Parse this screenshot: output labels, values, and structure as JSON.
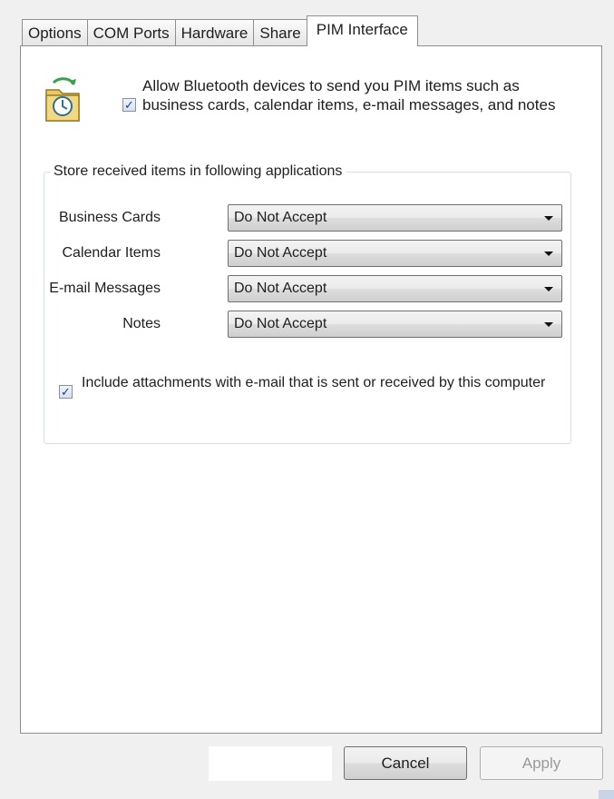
{
  "tabs": [
    {
      "label": "Options"
    },
    {
      "label": "COM Ports"
    },
    {
      "label": "Hardware"
    },
    {
      "label": "Share"
    },
    {
      "label": "PIM Interface"
    }
  ],
  "allow_pim": {
    "checked": true,
    "label": "Allow Bluetooth devices to send you PIM items such as business cards, calendar items, e-mail messages, and notes",
    "check_glyph": "✓"
  },
  "store_group": {
    "title": "Store received items in following applications",
    "rows": [
      {
        "label": "Business Cards",
        "value": "Do Not Accept"
      },
      {
        "label": "Calendar Items",
        "value": "Do Not Accept"
      },
      {
        "label": "E-mail Messages",
        "value": "Do Not Accept"
      },
      {
        "label": "Notes",
        "value": "Do Not Accept"
      }
    ]
  },
  "include_attachments": {
    "checked": true,
    "label": "Include attachments with e-mail that is sent or received by this computer",
    "check_glyph": "✓"
  },
  "buttons": {
    "cancel": "Cancel",
    "apply": "Apply"
  },
  "icons": {
    "pim": "pim-exchange-icon",
    "dropdown": "chevron-down-icon"
  }
}
